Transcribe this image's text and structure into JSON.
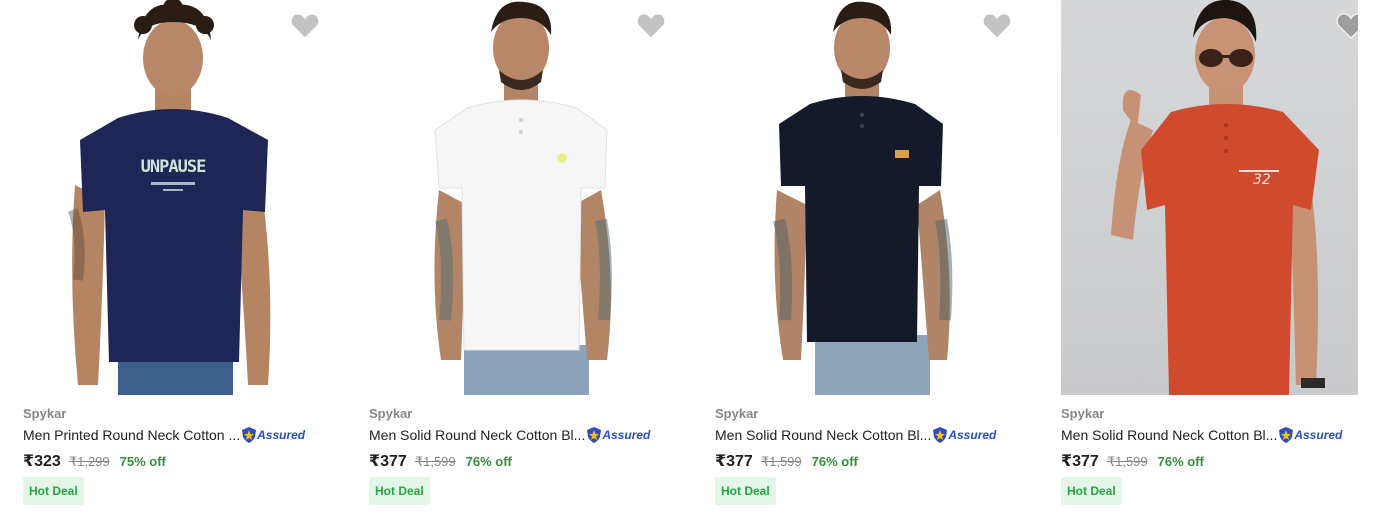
{
  "colors": {
    "accent_green": "#388e3c",
    "deal_bg": "#e3f6e8",
    "assured_blue": "#2c4fb8",
    "wishlist_grey": "#c2c2c2"
  },
  "products": [
    {
      "brand": "Spykar",
      "title": "Men Printed Round Neck Cotton ...",
      "assured_label": "Assured",
      "price": "₹323",
      "mrp": "₹1,299",
      "discount": "75% off",
      "badge": "Hot Deal",
      "shirt_color": "#1f2555",
      "print_text": "UNPAUSE",
      "background": "white"
    },
    {
      "brand": "Spykar",
      "title": "Men Solid Round Neck Cotton Bl...",
      "assured_label": "Assured",
      "price": "₹377",
      "mrp": "₹1,599",
      "discount": "76% off",
      "badge": "Hot Deal",
      "shirt_color": "#f8f8f8",
      "background": "white"
    },
    {
      "brand": "Spykar",
      "title": "Men Solid Round Neck Cotton Bl...",
      "assured_label": "Assured",
      "price": "₹377",
      "mrp": "₹1,599",
      "discount": "76% off",
      "badge": "Hot Deal",
      "shirt_color": "#151a2b",
      "background": "white"
    },
    {
      "brand": "Spykar",
      "title": "Men Solid Round Neck Cotton Bl...",
      "assured_label": "Assured",
      "price": "₹377",
      "mrp": "₹1,599",
      "discount": "76% off",
      "badge": "Hot Deal",
      "shirt_color": "#d04a2e",
      "background": "grey"
    }
  ]
}
